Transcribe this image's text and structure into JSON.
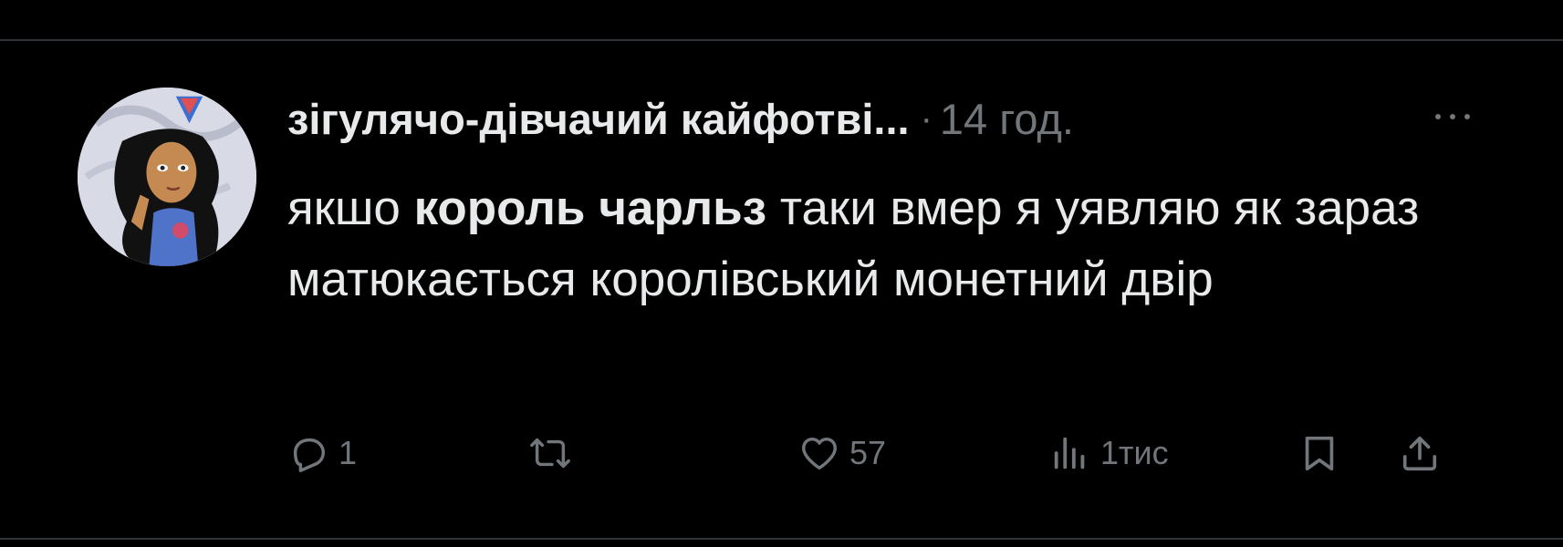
{
  "post": {
    "author": "зігулячо-дівчачий кайфотві...",
    "separator": "·",
    "time": "14 год.",
    "text": {
      "part1": "якшо ",
      "bold": "король чарльз",
      "part2": " таки вмер я уявляю як зараз матюкається королівський монетний двір"
    }
  },
  "actions": {
    "reply_count": "1",
    "retweet_count": "",
    "like_count": "57",
    "views_count": "1тис"
  },
  "icons": {
    "more": "more-horizontal-icon",
    "reply": "reply-icon",
    "retweet": "retweet-icon",
    "like": "heart-icon",
    "views": "views-icon",
    "bookmark": "bookmark-icon",
    "share": "share-icon"
  },
  "colors": {
    "background": "#000000",
    "text": "#e7e9ea",
    "secondary": "#71767b",
    "divider": "#2f3336"
  }
}
